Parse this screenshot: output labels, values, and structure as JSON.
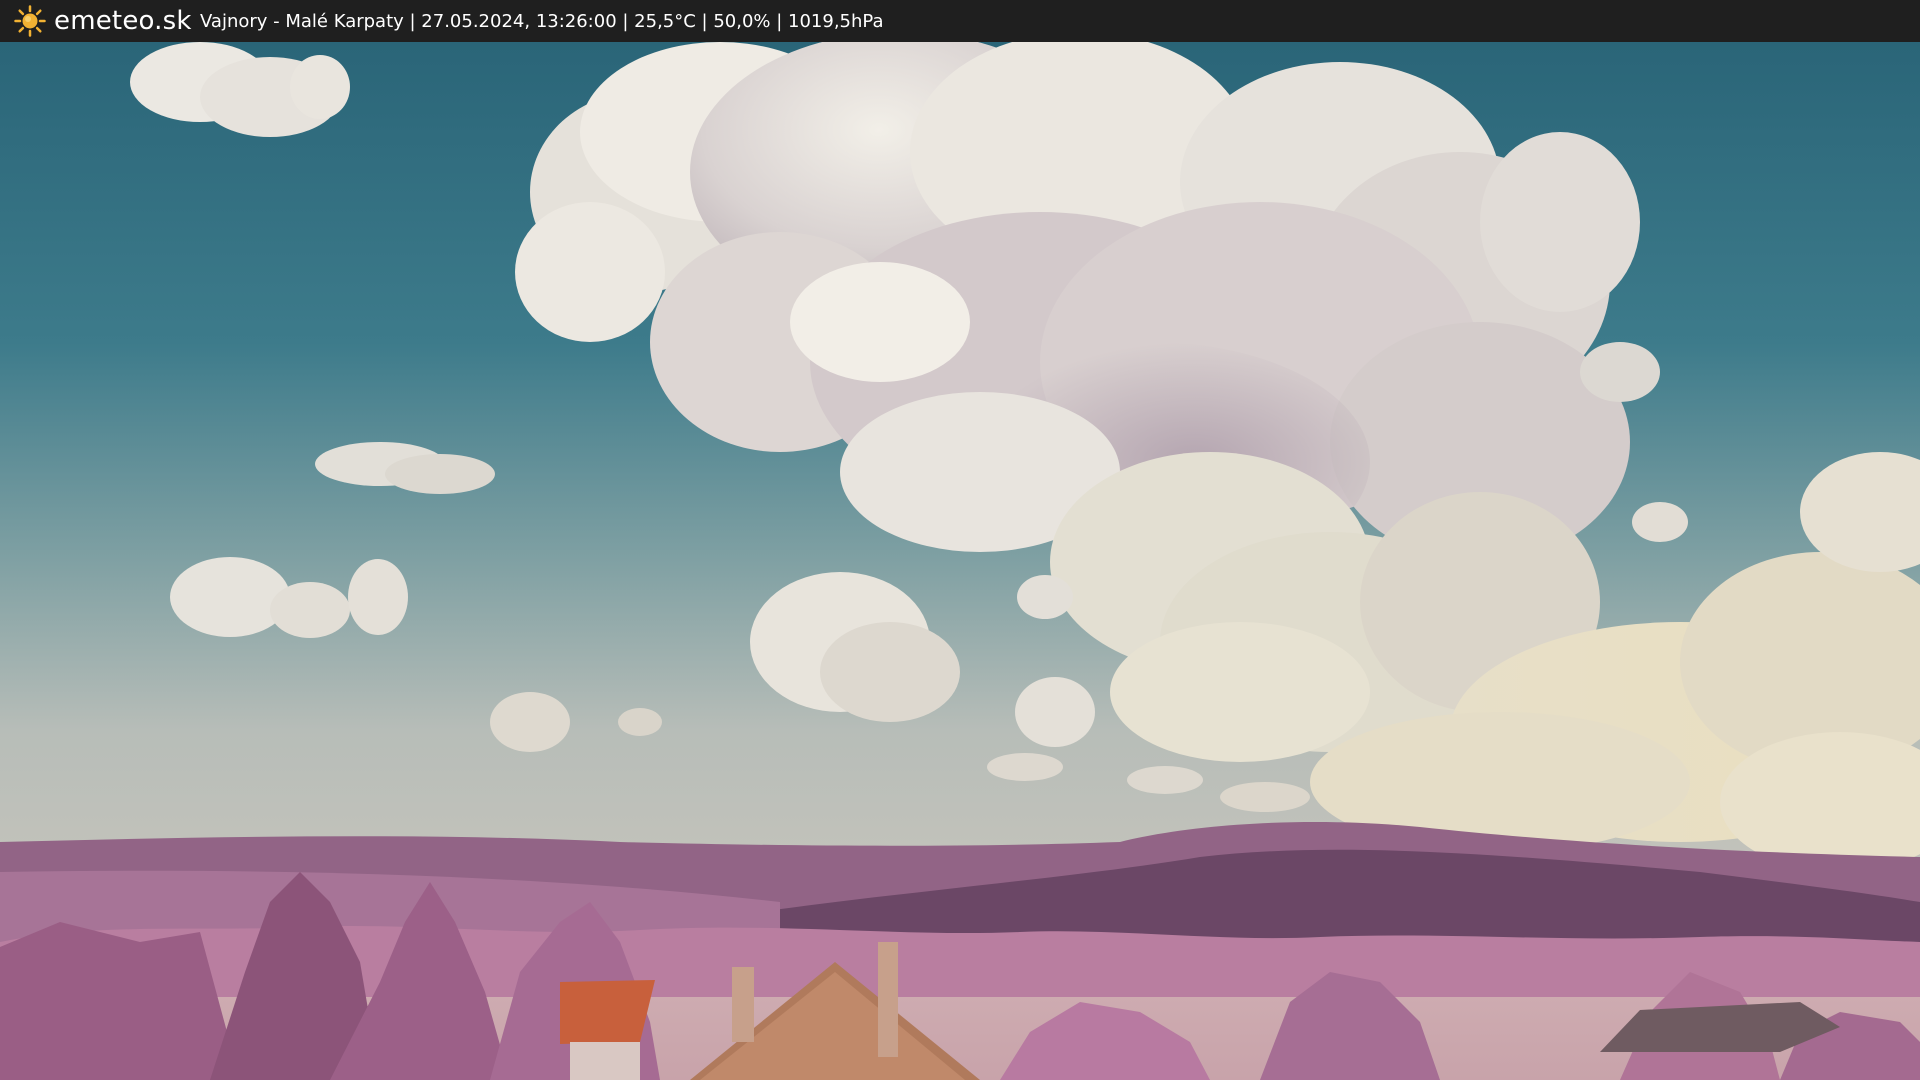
{
  "header": {
    "brand": "emeteo.sk",
    "brand_icon": "sun-icon",
    "info": "Vajnory - Malé Karpaty | 27.05.2024, 13:26:00 | 25,5°C | 50,0% | 1019,5hPa"
  },
  "colors": {
    "bar_bg": "#1f1f1f",
    "sun": "#f2b233",
    "sky_top": "#2f6c80",
    "sky_horizon": "#b8bfbf",
    "hills": "#8a5a7c",
    "foliage": "#b77c9e",
    "roof": "#c8603c"
  }
}
